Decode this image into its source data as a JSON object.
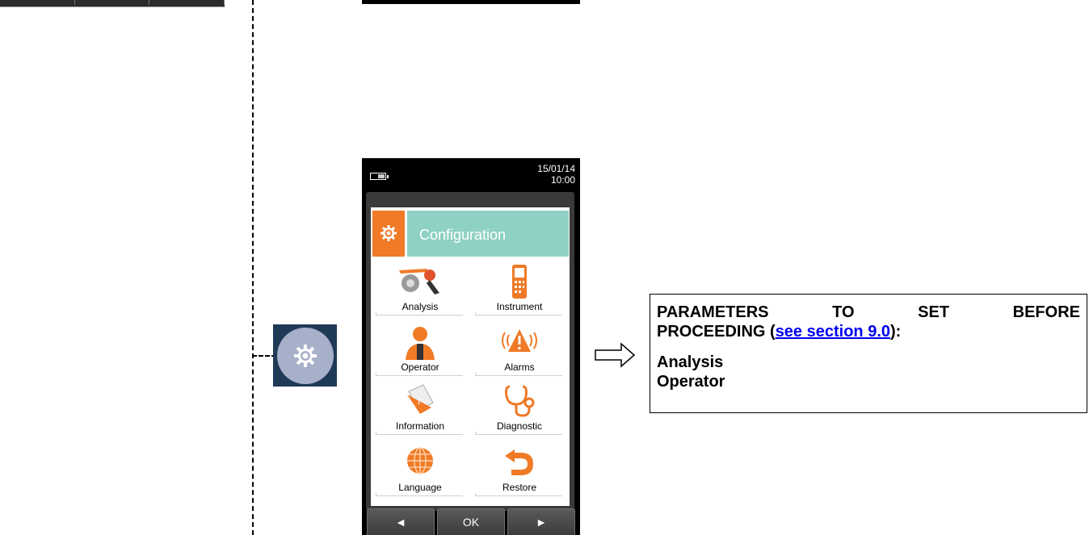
{
  "device": {
    "date": "15/01/14",
    "time": "10:00",
    "header_title": "Configuration",
    "menu_items": [
      {
        "label": "Analysis",
        "icon": "analysis-icon"
      },
      {
        "label": "Instrument",
        "icon": "instrument-icon"
      },
      {
        "label": "Operator",
        "icon": "operator-icon"
      },
      {
        "label": "Alarms",
        "icon": "alarms-icon"
      },
      {
        "label": "Information",
        "icon": "information-icon"
      },
      {
        "label": "Diagnostic",
        "icon": "diagnostic-icon"
      },
      {
        "label": "Language",
        "icon": "language-icon"
      },
      {
        "label": "Restore",
        "icon": "restore-icon"
      }
    ],
    "softkeys": {
      "left": "◄",
      "ok": "OK",
      "right": "►"
    }
  },
  "info_box": {
    "words": [
      "PARAMETERS",
      "TO",
      "SET",
      "BEFORE"
    ],
    "line2_prefix": "PROCEEDING (",
    "link_text": "see section 9.0",
    "line2_suffix": "):",
    "items": [
      "Analysis",
      "Operator"
    ]
  },
  "colors": {
    "accent_orange": "#f07a26",
    "header_teal": "#8fd1c4",
    "settings_tile": "#1f3a57",
    "link": "#0000ee"
  }
}
